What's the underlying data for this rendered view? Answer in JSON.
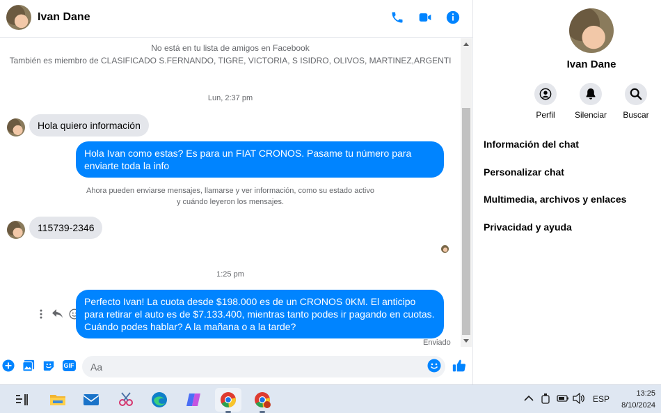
{
  "header": {
    "name": "Ivan Dane"
  },
  "messages": {
    "notice_line1": "No está en tu lista de amigos en Facebook",
    "notice_line2": "También es miembro de CLASIFICADO S.FERNANDO, TIGRE, VICTORIA, S ISIDRO, OLIVOS, MARTINEZ,ARGENTI",
    "timestamp1": "Lun, 2:37 pm",
    "in1": "Hola quiero información",
    "out1": "Hola Ivan como estas?  Es para un FIAT CRONOS. Pasame tu número para enviarte toda la info",
    "sys_line1": "Ahora pueden enviarse mensajes, llamarse y ver información, como su estado activo",
    "sys_line2": "y cuándo leyeron los mensajes.",
    "in2": "115739-2346",
    "timestamp2": "1:25 pm",
    "out2": "Perfecto Ivan! La cuota desde $198.000 es de un CRONOS 0KM. El anticipo para retirar el auto es de $7.133.400, mientras tanto podes ir pagando en cuotas. Cuándo podes hablar? A la mañana o a la tarde?",
    "status": "Enviado"
  },
  "composer": {
    "placeholder": "Aa",
    "gif_label": "GIF"
  },
  "info": {
    "name": "Ivan Dane",
    "actions": {
      "profile": "Perfil",
      "mute": "Silenciar",
      "search": "Buscar"
    },
    "menu": [
      "Información del chat",
      "Personalizar chat",
      "Multimedia, archivos y enlaces",
      "Privacidad y ayuda"
    ]
  },
  "taskbar": {
    "language": "ESP",
    "time": "13:25",
    "date": "8/10/2024"
  },
  "colors": {
    "accent": "#0084ff",
    "incoming_bubble": "#e4e6eb",
    "taskbar": "#dfe7f2"
  }
}
